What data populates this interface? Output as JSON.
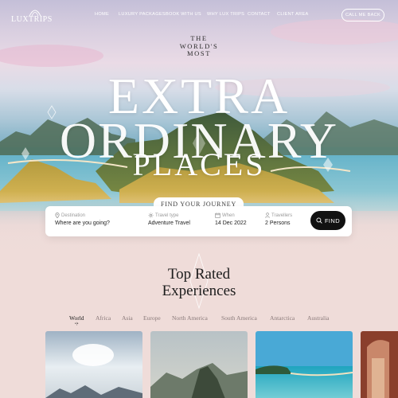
{
  "brand": {
    "name": "LUXTRIPS"
  },
  "nav": {
    "items": [
      "HOME",
      "LUXURY PACKAGES",
      "BOOK WITH US",
      "WHY LUX TRIPS",
      "CONTACT",
      "CLIENT AREA"
    ],
    "cta": "CALL ME BACK"
  },
  "hero": {
    "kicker": [
      "THE",
      "WORLD'S",
      "MOST"
    ],
    "headline": [
      "EXTRA",
      "ORDINARY",
      "PLACES"
    ]
  },
  "search": {
    "tab": "FIND YOUR JOURNEY",
    "fields": [
      {
        "label": "Destination",
        "value": "Where are you going?",
        "icon": "pin-icon"
      },
      {
        "label": "Travel type",
        "value": "Adventure Travel",
        "icon": "sun-icon"
      },
      {
        "label": "When",
        "value": "14 Dec 2022",
        "icon": "calendar-icon"
      },
      {
        "label": "Travellers",
        "value": "2 Persons",
        "icon": "person-icon"
      }
    ],
    "button": "FIND"
  },
  "section": {
    "title": [
      "Top Rated",
      "Experiences"
    ],
    "tabs": [
      "World",
      "Africa",
      "Asia",
      "Europe",
      "North America",
      "South America",
      "Antarctica",
      "Australia"
    ],
    "active_tab": "World",
    "active_mark": "•|•"
  },
  "colors": {
    "accent": "#111111",
    "background": "#efdcd9",
    "muted": "#8a7a7a"
  }
}
